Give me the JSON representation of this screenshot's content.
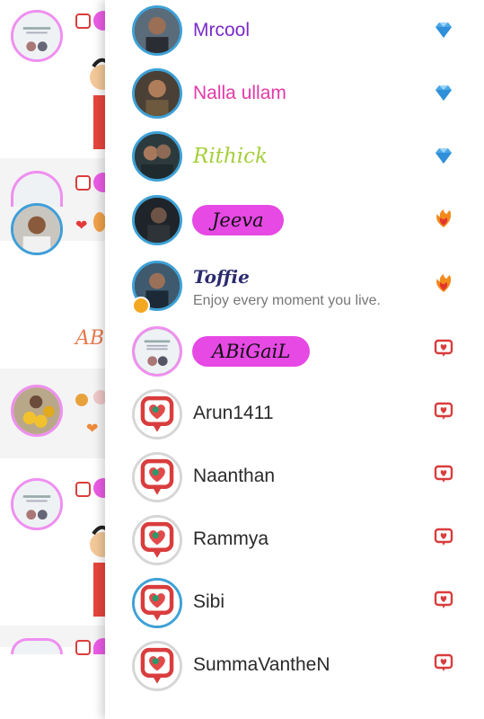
{
  "colors": {
    "accent_pink": "#e649e4",
    "ring_blue": "#3ea1d6",
    "ring_pink": "#f090ef",
    "ring_grey": "#d6d6d6",
    "name_purple": "#7a2bc7",
    "name_magenta": "#e23aa8",
    "name_green": "#a6cf3c",
    "badge_red": "#d93d3d"
  },
  "background": {
    "label_fragment": "AB"
  },
  "drawer": {
    "members": [
      {
        "name": "Mrcool",
        "rank_icon": "diamond-icon",
        "ring": "blue"
      },
      {
        "name": "Nalla ullam",
        "rank_icon": "diamond-icon",
        "ring": "blue"
      },
      {
        "name": "Rithick",
        "rank_icon": "diamond-icon",
        "ring": "blue"
      },
      {
        "name": "Jeeva",
        "rank_icon": "flame-heart-icon",
        "ring": "blue",
        "style": "pill"
      },
      {
        "name": "Toffie",
        "rank_icon": "flame-heart-icon",
        "ring": "blue",
        "status": "Enjoy every moment you live.",
        "badge": "clock-icon"
      },
      {
        "name": "ABiGaiL",
        "rank_icon": "chat-badge-icon",
        "ring": "pink",
        "style": "pill"
      },
      {
        "name": "Arun1411",
        "rank_icon": "chat-badge-icon",
        "ring": "grey"
      },
      {
        "name": "Naanthan",
        "rank_icon": "chat-badge-icon",
        "ring": "grey"
      },
      {
        "name": "Rammya",
        "rank_icon": "chat-badge-icon",
        "ring": "grey"
      },
      {
        "name": "Sibi",
        "rank_icon": "chat-badge-icon",
        "ring": "blue"
      },
      {
        "name": "SummaVantheN",
        "rank_icon": "chat-badge-icon",
        "ring": "grey"
      }
    ]
  }
}
